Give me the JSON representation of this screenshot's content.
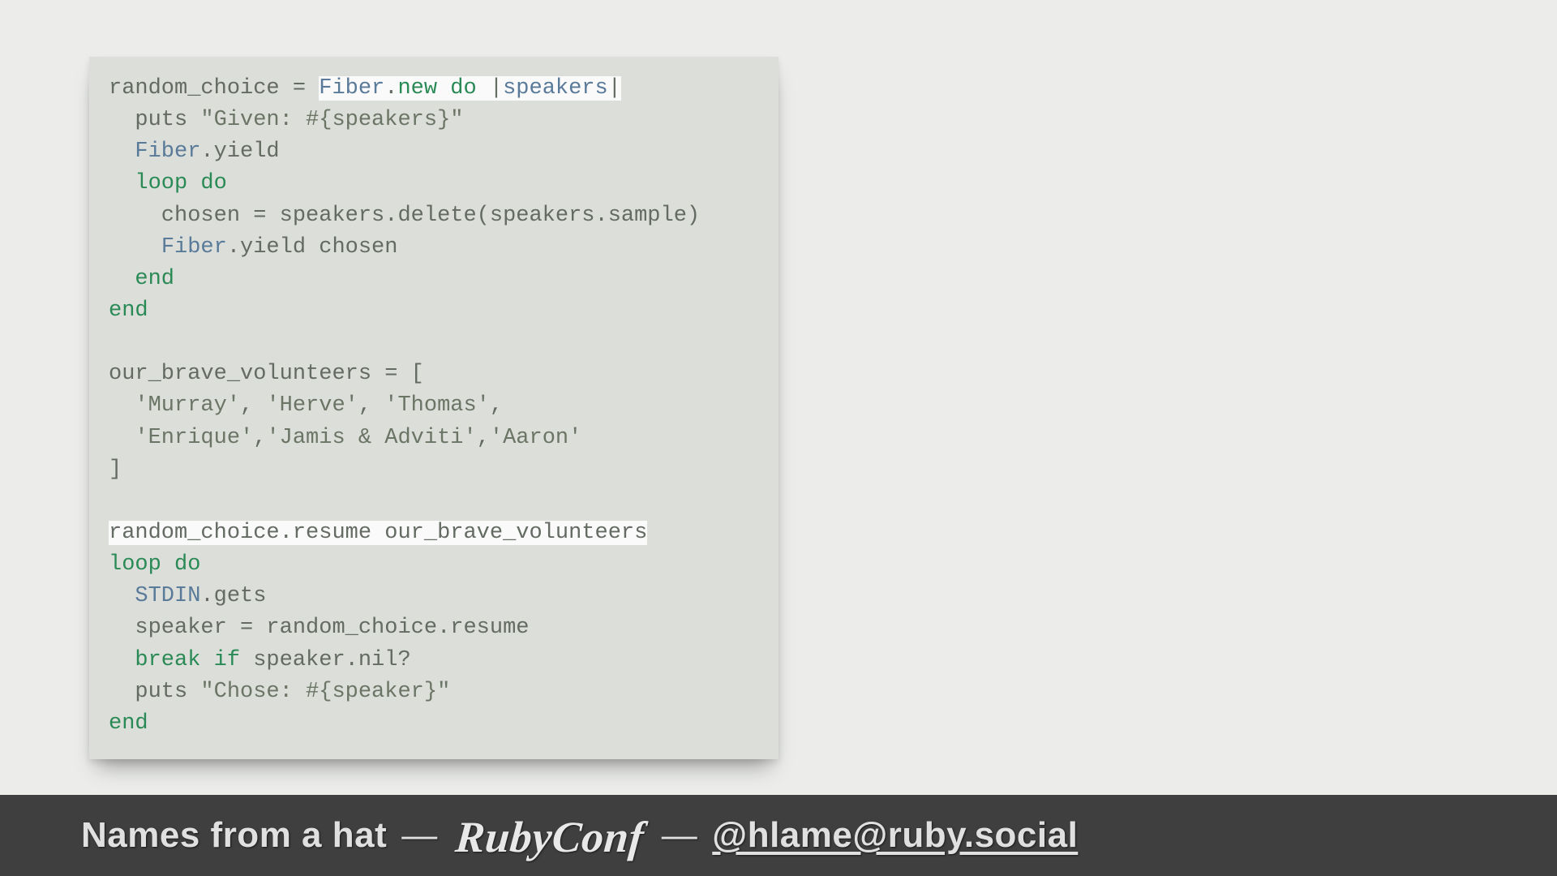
{
  "code": {
    "tokens": [
      {
        "t": "random_choice = ",
        "c": "var"
      },
      {
        "t": "Fiber",
        "c": "const hl"
      },
      {
        "t": ".",
        "c": "var hl"
      },
      {
        "t": "new",
        "c": "kw hl"
      },
      {
        "t": " ",
        "c": "var hl"
      },
      {
        "t": "do",
        "c": "kw hl"
      },
      {
        "t": " |",
        "c": "var hl"
      },
      {
        "t": "speakers",
        "c": "const hl"
      },
      {
        "t": "|",
        "c": "var hl"
      },
      {
        "t": "\n",
        "c": ""
      },
      {
        "t": "  puts ",
        "c": "var"
      },
      {
        "t": "\"Given: #{speakers}\"",
        "c": "str"
      },
      {
        "t": "\n",
        "c": ""
      },
      {
        "t": "  ",
        "c": "var"
      },
      {
        "t": "Fiber",
        "c": "const"
      },
      {
        "t": ".yield",
        "c": "var"
      },
      {
        "t": "\n",
        "c": ""
      },
      {
        "t": "  ",
        "c": "var"
      },
      {
        "t": "loop",
        "c": "kw"
      },
      {
        "t": " ",
        "c": "var"
      },
      {
        "t": "do",
        "c": "kw"
      },
      {
        "t": "\n",
        "c": ""
      },
      {
        "t": "    chosen = speakers.delete(speakers.sample)",
        "c": "var"
      },
      {
        "t": "\n",
        "c": ""
      },
      {
        "t": "    ",
        "c": "var"
      },
      {
        "t": "Fiber",
        "c": "const"
      },
      {
        "t": ".yield chosen",
        "c": "var"
      },
      {
        "t": "\n",
        "c": ""
      },
      {
        "t": "  ",
        "c": "var"
      },
      {
        "t": "end",
        "c": "kw"
      },
      {
        "t": "\n",
        "c": ""
      },
      {
        "t": "end",
        "c": "kw"
      },
      {
        "t": "\n",
        "c": ""
      },
      {
        "t": "\n",
        "c": ""
      },
      {
        "t": "our_brave_volunteers = [",
        "c": "var"
      },
      {
        "t": "\n",
        "c": ""
      },
      {
        "t": "  ",
        "c": "var"
      },
      {
        "t": "'Murray'",
        "c": "str"
      },
      {
        "t": ", ",
        "c": "var"
      },
      {
        "t": "'Herve'",
        "c": "str"
      },
      {
        "t": ", ",
        "c": "var"
      },
      {
        "t": "'Thomas'",
        "c": "str"
      },
      {
        "t": ",",
        "c": "var"
      },
      {
        "t": "\n",
        "c": ""
      },
      {
        "t": "  ",
        "c": "var"
      },
      {
        "t": "'Enrique'",
        "c": "str"
      },
      {
        "t": ",",
        "c": "var"
      },
      {
        "t": "'Jamis & Adviti'",
        "c": "str"
      },
      {
        "t": ",",
        "c": "var"
      },
      {
        "t": "'Aaron'",
        "c": "str"
      },
      {
        "t": "\n",
        "c": ""
      },
      {
        "t": "]",
        "c": "var"
      },
      {
        "t": "\n",
        "c": ""
      },
      {
        "t": "\n",
        "c": ""
      },
      {
        "t": "random_choice.resume our_brave_volunteers",
        "c": "var hl"
      },
      {
        "t": "\n",
        "c": ""
      },
      {
        "t": "loop",
        "c": "kw"
      },
      {
        "t": " ",
        "c": "var"
      },
      {
        "t": "do",
        "c": "kw"
      },
      {
        "t": "\n",
        "c": ""
      },
      {
        "t": "  ",
        "c": "var"
      },
      {
        "t": "STDIN",
        "c": "const"
      },
      {
        "t": ".gets",
        "c": "var"
      },
      {
        "t": "\n",
        "c": ""
      },
      {
        "t": "  speaker = random_choice.resume",
        "c": "var"
      },
      {
        "t": "\n",
        "c": ""
      },
      {
        "t": "  ",
        "c": "var"
      },
      {
        "t": "break",
        "c": "kw"
      },
      {
        "t": " ",
        "c": "var"
      },
      {
        "t": "if",
        "c": "kw"
      },
      {
        "t": " speaker.nil?",
        "c": "var"
      },
      {
        "t": "\n",
        "c": ""
      },
      {
        "t": "  puts ",
        "c": "var"
      },
      {
        "t": "\"Chose: #{speaker}\"",
        "c": "str"
      },
      {
        "t": "\n",
        "c": ""
      },
      {
        "t": "end",
        "c": "kw"
      }
    ]
  },
  "footer": {
    "title": "Names from a hat",
    "sep": "—",
    "logo": "RubyConf",
    "handle": "@hlame@ruby.social"
  }
}
